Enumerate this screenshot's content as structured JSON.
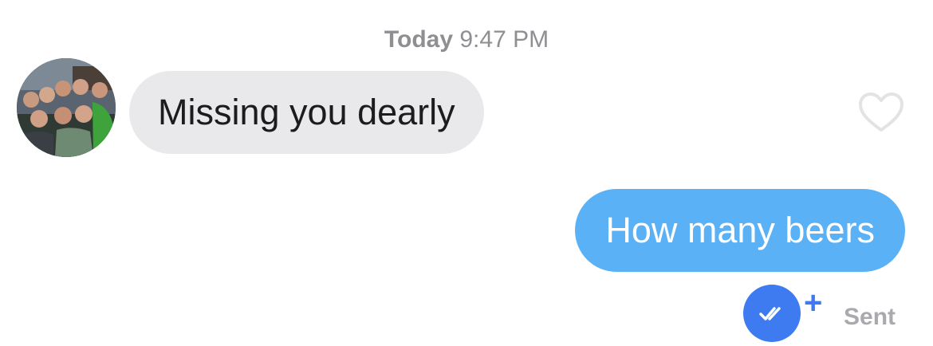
{
  "thread": {
    "timestamp_day": "Today",
    "timestamp_time": "9:47 PM"
  },
  "messages": [
    {
      "direction": "incoming",
      "text": "Missing you dearly"
    },
    {
      "direction": "outgoing",
      "text": "How many beers"
    }
  ],
  "status": {
    "label": "Sent",
    "plus": "+"
  },
  "icons": {
    "like": "heart-icon",
    "read_receipt": "double-check-icon"
  },
  "colors": {
    "incoming_bubble": "#e9e9eb",
    "outgoing_bubble": "#5bb1f5",
    "accent": "#3e7bf0",
    "muted_text": "#8e8e93"
  }
}
